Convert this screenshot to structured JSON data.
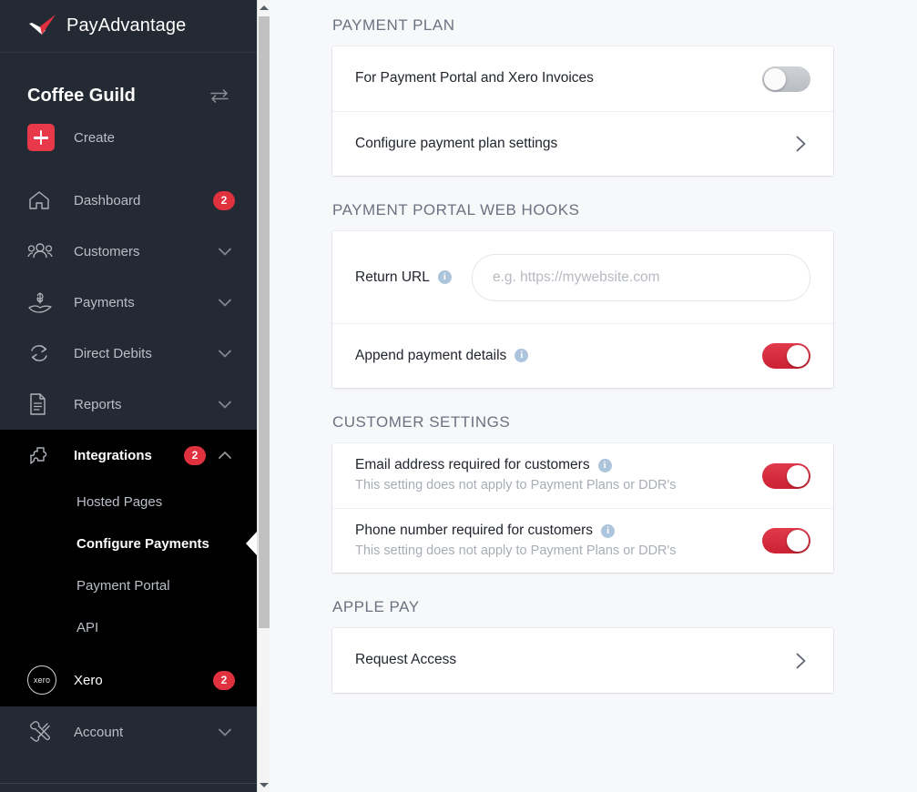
{
  "sidebar": {
    "brand_name": "PayAdvantage",
    "brand_logo_icon": "payadvantage-swoosh-logo",
    "org_name": "Coffee Guild",
    "switch_org_icon": "switch-arrows-icon",
    "create_label": "Create",
    "create_icon": "plus-icon",
    "nav": [
      {
        "label": "Dashboard",
        "icon": "home-icon",
        "badge": "2",
        "chevron": ""
      },
      {
        "label": "Customers",
        "icon": "people-icon",
        "badge": "",
        "chevron": "down"
      },
      {
        "label": "Payments",
        "icon": "hand-dollar-icon",
        "badge": "",
        "chevron": "down"
      },
      {
        "label": "Direct Debits",
        "icon": "recycle-arrows-icon",
        "badge": "",
        "chevron": "down"
      },
      {
        "label": "Reports",
        "icon": "document-icon",
        "badge": "",
        "chevron": "down"
      },
      {
        "label": "Integrations",
        "icon": "puzzle-piece-icon",
        "badge": "2",
        "chevron": "up"
      }
    ],
    "submenu": [
      {
        "label": "Hosted Pages",
        "selected": false
      },
      {
        "label": "Configure Payments",
        "selected": true
      },
      {
        "label": "Payment Portal",
        "selected": false
      },
      {
        "label": "API",
        "selected": false
      }
    ],
    "xero": {
      "label": "Xero",
      "icon_text": "xero",
      "badge": "2"
    },
    "account": {
      "label": "Account",
      "icon": "tools-icon",
      "chevron": "down"
    }
  },
  "main": {
    "sections": [
      {
        "title": "PAYMENT PLAN",
        "rows": [
          {
            "type": "toggle",
            "label": "For Payment Portal and Xero Invoices",
            "info": false,
            "toggle_on": false
          },
          {
            "type": "link",
            "label": "Configure payment plan settings",
            "chevron_icon": "chevron-right-icon"
          }
        ]
      },
      {
        "title": "PAYMENT PORTAL WEB HOOKS",
        "rows": [
          {
            "type": "input",
            "label": "Return URL",
            "info": true,
            "value": "",
            "placeholder": "e.g. https://mywebsite.com"
          },
          {
            "type": "toggle",
            "label": "Append payment details",
            "info": true,
            "toggle_on": true
          }
        ]
      },
      {
        "title": "CUSTOMER SETTINGS",
        "rows": [
          {
            "type": "toggle",
            "label": "Email address required for customers",
            "sub": "This setting does not apply to Payment Plans or DDR's",
            "info": true,
            "toggle_on": true
          },
          {
            "type": "toggle",
            "label": "Phone number required for customers",
            "sub": "This setting does not apply to Payment Plans or DDR's",
            "info": true,
            "toggle_on": true
          }
        ]
      },
      {
        "title": "APPLE PAY",
        "rows": [
          {
            "type": "link",
            "label": "Request Access",
            "chevron_icon": "chevron-right-icon"
          }
        ]
      }
    ]
  },
  "colors": {
    "sidebar_bg": "#242a33",
    "sidebar_active_bg": "#000000",
    "accent_red": "#e0313f",
    "toggle_on": "#d9293b",
    "main_bg": "#f7f8fa",
    "info_icon": "#adc4dd"
  },
  "scrollbar": {
    "up_icon": "scroll-up-arrow-icon",
    "down_icon": "scroll-down-arrow-icon"
  }
}
